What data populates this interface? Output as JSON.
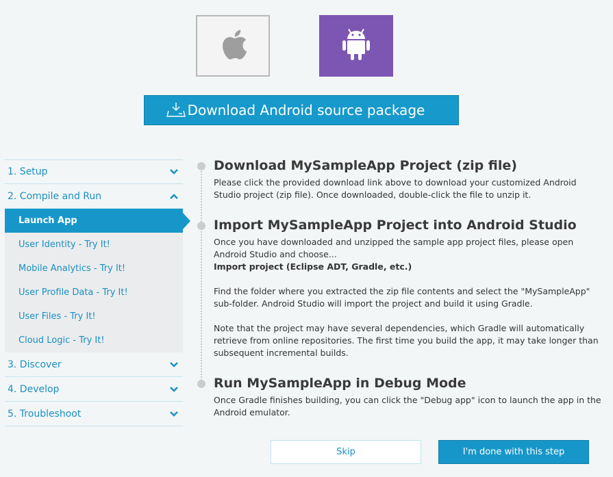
{
  "platforms": [
    {
      "name": "iOS",
      "icon": "apple-icon"
    },
    {
      "name": "Android",
      "icon": "android-icon",
      "selected": true
    }
  ],
  "download": {
    "label": "Download Android source package",
    "icon": "download-icon"
  },
  "sidebar": {
    "steps": [
      {
        "label": "1. Setup",
        "expanded": false
      },
      {
        "label": "2. Compile and Run",
        "expanded": true,
        "sub": [
          {
            "label": "Launch App",
            "active": true
          },
          {
            "label": "User Identity - Try It!"
          },
          {
            "label": "Mobile Analytics - Try It!"
          },
          {
            "label": "User Profile Data - Try It!"
          },
          {
            "label": "User Files - Try It!"
          },
          {
            "label": "Cloud Logic - Try It!"
          }
        ]
      },
      {
        "label": "3. Discover",
        "expanded": false
      },
      {
        "label": "4. Develop",
        "expanded": false
      },
      {
        "label": "5. Troubleshoot",
        "expanded": false
      }
    ]
  },
  "content": {
    "step1": {
      "title": "Download MySampleApp Project (zip file)",
      "line1": "Please click the provided download link above to download your customized Android",
      "line2": "Studio project (zip file). Once downloaded, double-click the file to unzip it."
    },
    "step2": {
      "title": "Import MySampleApp Project into Android Studio",
      "line1": "Once you have downloaded and unzipped the sample app project files, please open",
      "line2": "Android Studio and choose...",
      "line3": "Import project (Eclipse ADT, Gradle, etc.)",
      "line4": "Find the folder where you extracted the zip file contents and select the \"MySampleApp\"",
      "line5": "sub-folder. Android Studio will import the project and build it using Gradle.",
      "line6": "Note that the project may have several dependencies, which Gradle will automatically",
      "line7": "retrieve from online repositories. The first time you build the app, it may take longer than",
      "line8": "subsequent incremental builds."
    },
    "step3": {
      "title": "Run MySampleApp in Debug Mode",
      "line1": "Once Gradle finishes building, you can click the \"Debug app\" icon to launch the app in the",
      "line2": "Android emulator."
    }
  },
  "actions": {
    "skip": "Skip",
    "done": "I'm done with this step"
  },
  "colors": {
    "accent": "#1797c9",
    "android": "#7d55b3",
    "background": "#f3f6f7"
  }
}
